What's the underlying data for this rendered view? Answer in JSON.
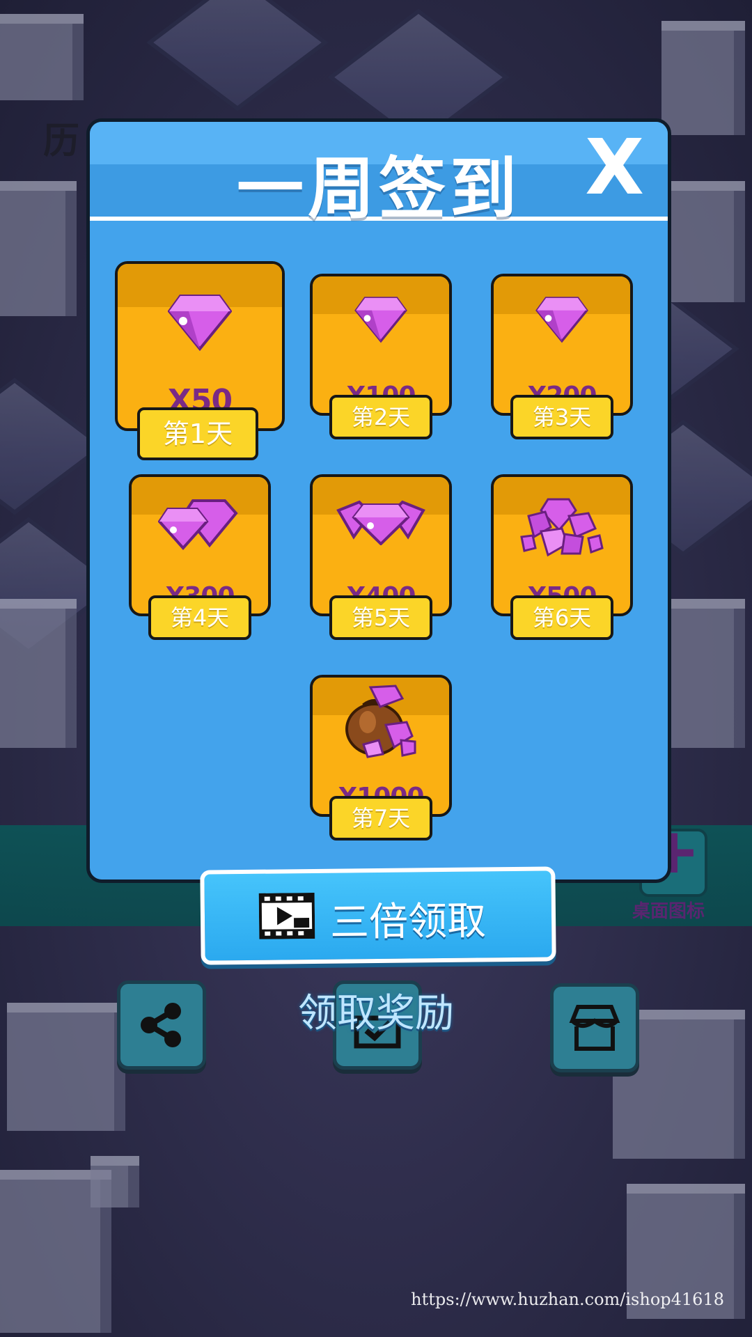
{
  "background": {
    "history_label": "历",
    "desktop_icon_glyph": "+",
    "desktop_icon_label": "桌面图标"
  },
  "dialog": {
    "title": "一周签到",
    "close_label": "X",
    "rewards": [
      {
        "day": "第1天",
        "amount": "X50",
        "icon": "single-gem-icon"
      },
      {
        "day": "第2天",
        "amount": "X100",
        "icon": "single-gem-icon"
      },
      {
        "day": "第3天",
        "amount": "X200",
        "icon": "single-gem-icon"
      },
      {
        "day": "第4天",
        "amount": "X300",
        "icon": "two-gems-icon"
      },
      {
        "day": "第5天",
        "amount": "X400",
        "icon": "three-gems-icon"
      },
      {
        "day": "第6天",
        "amount": "X500",
        "icon": "gem-pile-icon"
      },
      {
        "day": "第7天",
        "amount": "X1000",
        "icon": "gem-sack-icon"
      }
    ]
  },
  "buttons": {
    "triple_claim": "三倍领取",
    "claim_reward": "领取奖励"
  },
  "dock": {
    "share_icon": "share-icon",
    "checkin_icon": "checkin-icon",
    "shop_icon": "shop-icon"
  },
  "watermark": "https://www.huzhan.com/ishop41618",
  "colors": {
    "dialog_bg": "#43a3ec",
    "card_bg": "#fbb012",
    "day_label_bg": "#fbd528",
    "amount_text": "#7a2a86",
    "gem": "#d65ee9"
  }
}
